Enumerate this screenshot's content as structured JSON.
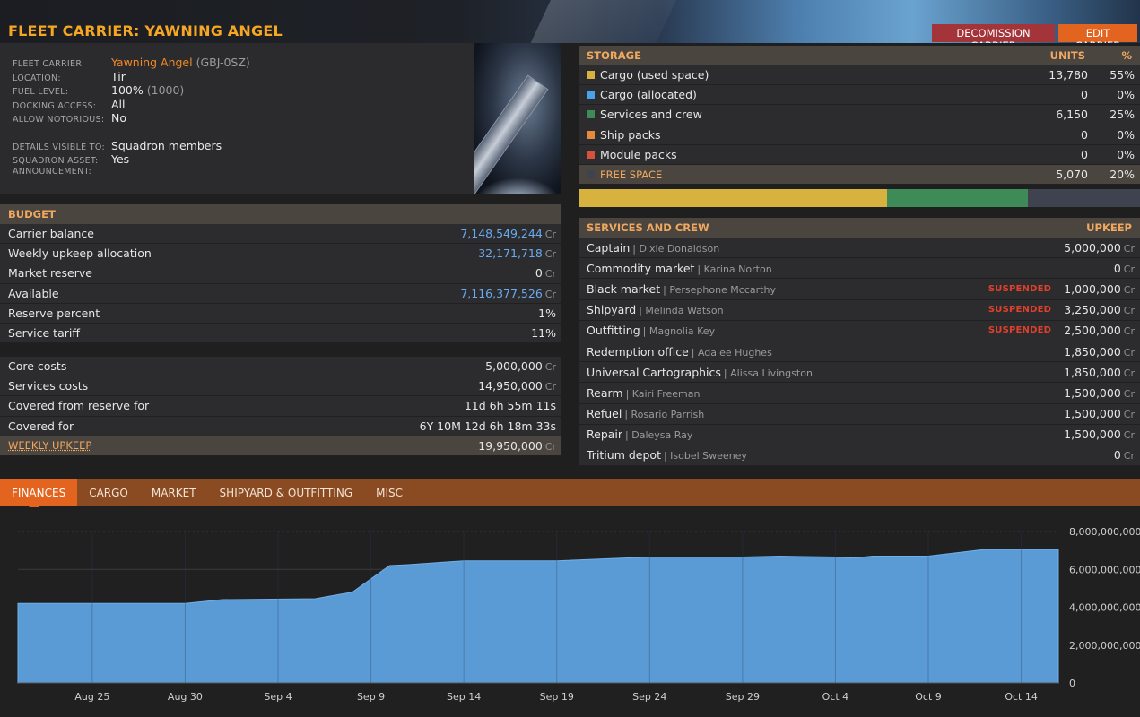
{
  "header": {
    "title": "FLEET CARRIER: YAWNING ANGEL",
    "decommission_label": "DECOMISSION CARRIER",
    "edit_label": "EDIT CARRIER"
  },
  "info": {
    "fleet_carrier_label": "FLEET CARRIER:",
    "carrier_name": "Yawning Angel",
    "carrier_id": "(GBJ-0SZ)",
    "location_label": "LOCATION:",
    "location": "Tir",
    "fuel_label": "FUEL LEVEL:",
    "fuel_pct": "100%",
    "fuel_amount": "(1000)",
    "docking_label": "DOCKING ACCESS:",
    "docking": "All",
    "notorious_label": "ALLOW NOTORIOUS:",
    "notorious": "No",
    "visible_label": "DETAILS VISIBLE TO:",
    "visible": "Squadron members",
    "squadron_label": "SQUADRON ASSET:",
    "squadron": "Yes",
    "announcement_label": "ANNOUNCEMENT:"
  },
  "budget": {
    "heading": "BUDGET",
    "currency": "Cr",
    "rows": [
      {
        "label": "Carrier balance",
        "value": "7,148,549,244"
      },
      {
        "label": "Weekly upkeep allocation",
        "value": "32,171,718"
      },
      {
        "label": "Market reserve",
        "value": "0"
      },
      {
        "label": "Available",
        "value": "7,116,377,526"
      },
      {
        "label": "Reserve percent",
        "value": "1%"
      },
      {
        "label": "Service tariff",
        "value": "11%"
      }
    ]
  },
  "costs": {
    "rows": [
      {
        "label": "Core costs",
        "value": "5,000,000"
      },
      {
        "label": "Services costs",
        "value": "14,950,000"
      },
      {
        "label": "Covered from reserve for",
        "value": "11d 6h 55m 11s"
      },
      {
        "label": "Covered for",
        "value": "6Y 10M 12d 6h 18m 33s"
      }
    ],
    "weekly_label": "WEEKLY UPKEEP",
    "weekly_value": "19,950,000"
  },
  "storage": {
    "heading": "STORAGE",
    "units_heading": "UNITS",
    "pct_heading": "%",
    "rows": [
      {
        "label": "Cargo (used space)",
        "units": "13,780",
        "pct": "55%",
        "color": "#d8b23e"
      },
      {
        "label": "Cargo (allocated)",
        "units": "0",
        "pct": "0%",
        "color": "#4aa3e8"
      },
      {
        "label": "Services and crew",
        "units": "6,150",
        "pct": "25%",
        "color": "#3e8b57"
      },
      {
        "label": "Ship packs",
        "units": "0",
        "pct": "0%",
        "color": "#e38a3c"
      },
      {
        "label": "Module packs",
        "units": "0",
        "pct": "0%",
        "color": "#d4533a"
      }
    ],
    "free_label": "FREE SPACE",
    "free_units": "5,070",
    "free_pct": "20%",
    "free_color": "#3f4350",
    "bar_fractions": [
      0.55,
      0.25,
      0.2
    ]
  },
  "services": {
    "heading": "SERVICES AND CREW",
    "upkeep_heading": "UPKEEP",
    "suspended_label": "SUSPENDED",
    "rows": [
      {
        "service": "Captain",
        "crew": "Dixie Donaldson",
        "upkeep": "5,000,000",
        "suspended": false
      },
      {
        "service": "Commodity market",
        "crew": "Karina Norton",
        "upkeep": "0",
        "suspended": false
      },
      {
        "service": "Black market",
        "crew": "Persephone Mccarthy",
        "upkeep": "1,000,000",
        "suspended": true
      },
      {
        "service": "Shipyard",
        "crew": "Melinda Watson",
        "upkeep": "3,250,000",
        "suspended": true
      },
      {
        "service": "Outfitting",
        "crew": "Magnolia Key",
        "upkeep": "2,500,000",
        "suspended": true
      },
      {
        "service": "Redemption office",
        "crew": "Adalee Hughes",
        "upkeep": "1,850,000",
        "suspended": false
      },
      {
        "service": "Universal Cartographics",
        "crew": "Alissa Livingston",
        "upkeep": "1,850,000",
        "suspended": false
      },
      {
        "service": "Rearm",
        "crew": "Kairi Freeman",
        "upkeep": "1,500,000",
        "suspended": false
      },
      {
        "service": "Refuel",
        "crew": "Rosario Parrish",
        "upkeep": "1,500,000",
        "suspended": false
      },
      {
        "service": "Repair",
        "crew": "Daleysa Ray",
        "upkeep": "1,500,000",
        "suspended": false
      },
      {
        "service": "Tritium depot",
        "crew": "Isobel Sweeney",
        "upkeep": "0",
        "suspended": false
      }
    ]
  },
  "tabs": [
    "FINANCES",
    "CARGO",
    "MARKET",
    "SHIPYARD & OUTFITTING",
    "MISC"
  ],
  "active_tab": "FINANCES",
  "chart_data": {
    "type": "area",
    "title": "",
    "xlabel": "",
    "ylabel": "",
    "ylim": [
      0,
      8000000000
    ],
    "y_ticks": [
      "0",
      "2,000,000,000",
      "4,000,000,000",
      "6,000,000,000",
      "8,000,000,000"
    ],
    "x_ticks": [
      "Aug 25",
      "Aug 30",
      "Sep 4",
      "Sep 9",
      "Sep 14",
      "Sep 19",
      "Sep 24",
      "Sep 29",
      "Oct 4",
      "Oct 9",
      "Oct 14"
    ],
    "x_start": "Aug 21",
    "x_end": "Oct 16",
    "color": "#5b9bd5",
    "series": [
      {
        "points": [
          [
            "Aug 21",
            4200000000
          ],
          [
            "Aug 30",
            4200000000
          ],
          [
            "Sep 1",
            4400000000
          ],
          [
            "Sep 6",
            4450000000
          ],
          [
            "Sep 8",
            4800000000
          ],
          [
            "Sep 10",
            6200000000
          ],
          [
            "Sep 11",
            6250000000
          ],
          [
            "Sep 14",
            6450000000
          ],
          [
            "Sep 19",
            6450000000
          ],
          [
            "Sep 24",
            6650000000
          ],
          [
            "Sep 29",
            6650000000
          ],
          [
            "Oct 1",
            6700000000
          ],
          [
            "Oct 4",
            6650000000
          ],
          [
            "Oct 5",
            6600000000
          ],
          [
            "Oct 6",
            6700000000
          ],
          [
            "Oct 9",
            6700000000
          ],
          [
            "Oct 12",
            7050000000
          ],
          [
            "Oct 14",
            7050000000
          ],
          [
            "Oct 16",
            7050000000
          ]
        ]
      }
    ]
  }
}
